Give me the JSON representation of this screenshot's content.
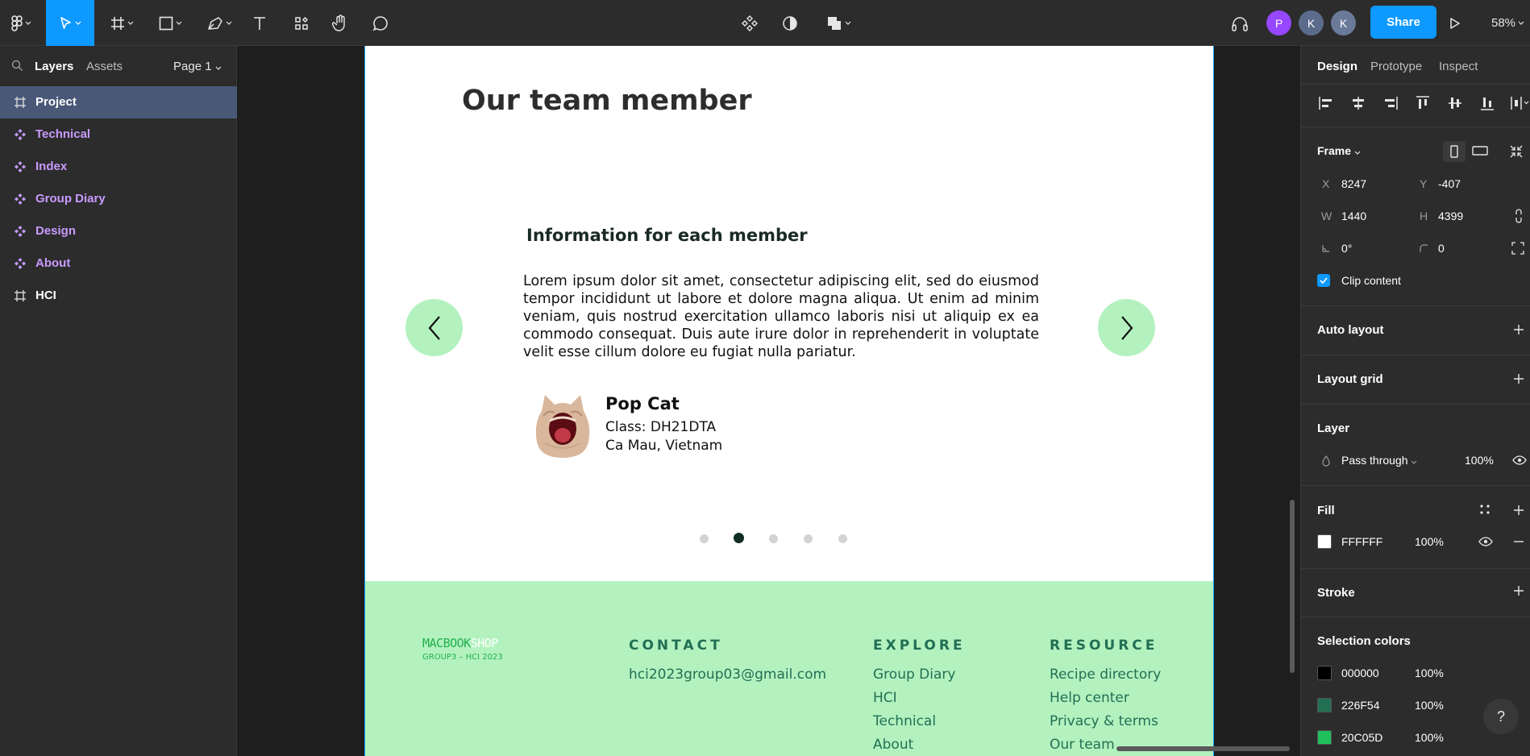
{
  "toolbar": {
    "share_label": "Share",
    "zoom_level": "58%",
    "avatars": [
      {
        "initial": "P",
        "color": "#9747ff"
      },
      {
        "initial": "K",
        "color": "#5b6b8c"
      },
      {
        "initial": "K",
        "color": "#6a7a99"
      }
    ]
  },
  "left_panel": {
    "tabs": {
      "layers": "Layers",
      "assets": "Assets"
    },
    "page_selector": "Page 1",
    "layers": [
      {
        "name": "Project",
        "type": "frame"
      },
      {
        "name": "Technical",
        "type": "component"
      },
      {
        "name": "Index",
        "type": "component"
      },
      {
        "name": "Group Diary",
        "type": "component"
      },
      {
        "name": "Design",
        "type": "component"
      },
      {
        "name": "About",
        "type": "component"
      },
      {
        "name": "HCI",
        "type": "frame"
      }
    ]
  },
  "frame": {
    "title": "Our team member",
    "info_heading": "Information for each member",
    "lorem": "Lorem ipsum dolor sit amet, consectetur adipiscing elit, sed do eiusmod tempor incididunt ut labore et dolore magna aliqua. Ut enim ad minim veniam, quis nostrud exercitation ullamco laboris nisi ut aliquip ex ea commodo consequat. Duis aute irure dolor in reprehenderit in voluptate velit esse cillum dolore eu fugiat nulla pariatur.",
    "member": {
      "name": "Pop Cat",
      "class_line": "Class: DH21DTA",
      "place": "Ca Mau, Vietnam"
    },
    "carousel": {
      "count": 5,
      "active": 1
    }
  },
  "footer": {
    "logo_main": "MACBOOK",
    "logo_shop": "SHOP",
    "logo_sub": "GROUP3 – HCI 2023",
    "contact": {
      "heading": "CONTACT",
      "email": "hci2023group03@gmail.com"
    },
    "explore": {
      "heading": "EXPLORE",
      "links": [
        "Group Diary",
        "HCI",
        "Technical",
        "About"
      ]
    },
    "resource": {
      "heading": "RESOURCE",
      "links": [
        "Recipe directory",
        "Help center",
        "Privacy & terms",
        "Our team"
      ]
    }
  },
  "right_panel": {
    "tabs": {
      "design": "Design",
      "prototype": "Prototype",
      "inspect": "Inspect"
    },
    "frame_label": "Frame",
    "props": {
      "x_label": "X",
      "x": "8247",
      "y_label": "Y",
      "y": "-407",
      "w_label": "W",
      "w": "1440",
      "h_label": "H",
      "h": "4399",
      "rotation": "0°",
      "radius": "0"
    },
    "clip_content": "Clip content",
    "auto_layout": "Auto layout",
    "layout_grid": "Layout grid",
    "layer": {
      "title": "Layer",
      "blend": "Pass through",
      "opacity": "100%"
    },
    "fill": {
      "title": "Fill",
      "hex": "FFFFFF",
      "opacity": "100%"
    },
    "stroke": "Stroke",
    "selection_colors": {
      "title": "Selection colors",
      "items": [
        {
          "hex": "000000",
          "opacity": "100%",
          "color": "#000000"
        },
        {
          "hex": "226F54",
          "opacity": "100%",
          "color": "#226f54"
        },
        {
          "hex": "20C05D",
          "opacity": "100%",
          "color": "#20c05d"
        }
      ]
    },
    "help": "?"
  }
}
